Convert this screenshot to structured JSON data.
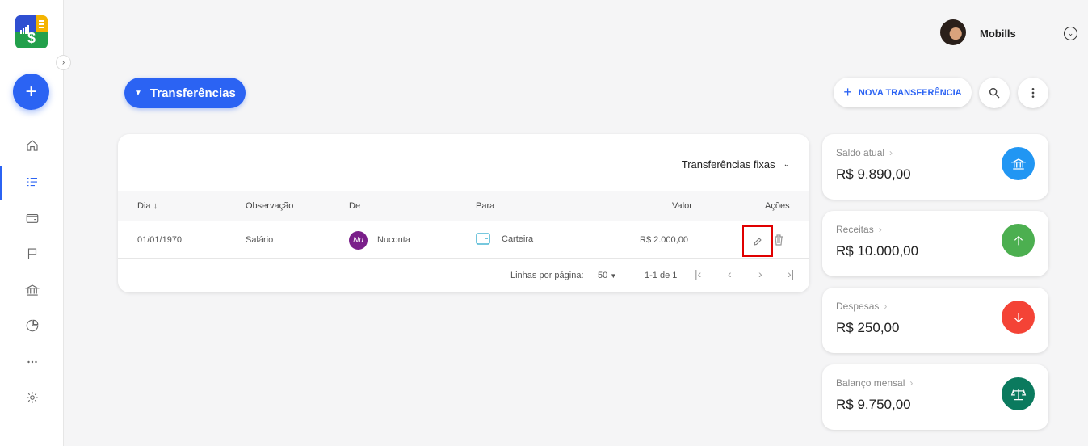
{
  "app": {
    "logo_symbol": "$"
  },
  "user": {
    "name": "Mobills"
  },
  "header": {
    "title": "Transferências",
    "new_button": "NOVA TRANSFERÊNCIA"
  },
  "filter": {
    "label": "Transferências fixas"
  },
  "table": {
    "columns": {
      "day": "Dia",
      "observation": "Observação",
      "from": "De",
      "to": "Para",
      "value": "Valor",
      "actions": "Ações"
    },
    "rows": [
      {
        "day": "01/01/1970",
        "observation": "Salário",
        "from": "Nuconta",
        "from_icon_text": "Nu",
        "to": "Carteira",
        "value": "R$ 2.000,00"
      }
    ]
  },
  "pagination": {
    "rows_label": "Linhas por página:",
    "rows_value": "50",
    "range": "1-1 de 1"
  },
  "summary": [
    {
      "label": "Saldo atual",
      "value": "R$ 9.890,00",
      "color": "#2196f3",
      "icon": "bank-icon"
    },
    {
      "label": "Receitas",
      "value": "R$ 10.000,00",
      "color": "#4caf50",
      "icon": "arrow-up-icon"
    },
    {
      "label": "Despesas",
      "value": "R$ 250,00",
      "color": "#f44336",
      "icon": "arrow-down-icon"
    },
    {
      "label": "Balanço mensal",
      "value": "R$ 9.750,00",
      "color": "#0b7a5e",
      "icon": "scale-icon"
    }
  ],
  "colors": {
    "accent": "#2b63f3",
    "highlight": "#e00000"
  }
}
